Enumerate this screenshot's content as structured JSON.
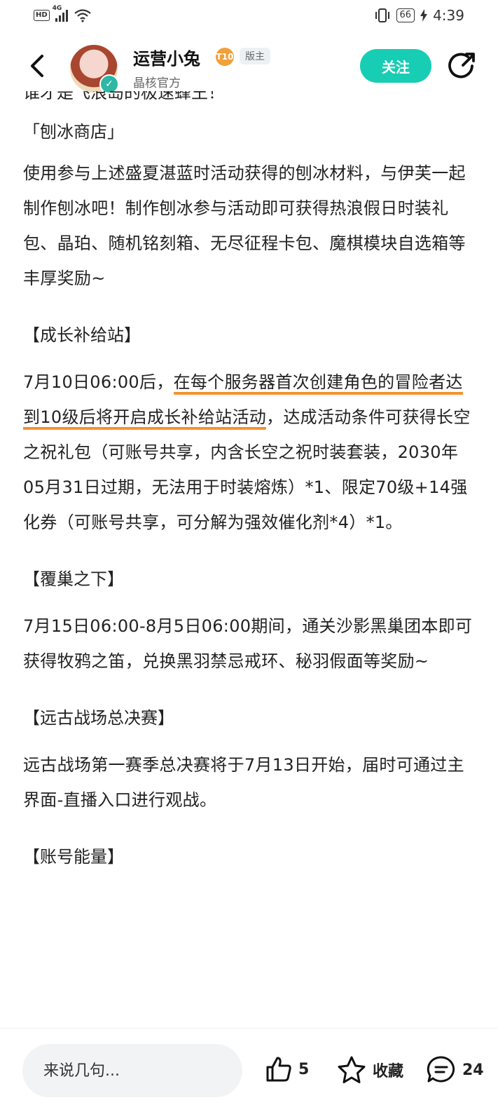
{
  "status_bar": {
    "hd": "HD",
    "network": "4G",
    "battery": "66",
    "time": "4:39"
  },
  "header": {
    "username": "运营小兔",
    "level": "T10",
    "badge": "版主",
    "subtitle": "晶核官方",
    "follow_label": "关注"
  },
  "content": {
    "cut_line": "谁才是飞浪岛的极速蜂王！",
    "sections": [
      {
        "title": "「刨冰商店」",
        "body": "使用参与上述盛夏湛蓝时活动获得的刨冰材料，与伊芙一起制作刨冰吧！制作刨冰参与活动即可获得热浪假日时装礼包、晶珀、随机铭刻箱、无尽征程卡包、魔棋模块自选箱等丰厚奖励~"
      },
      {
        "title": "【成长补给站】",
        "body_pre": "7月10日06:00后，",
        "body_highlight": "在每个服务器首次创建角色的冒险者达到10级后将开启成长补给站活动",
        "body_post": "，达成活动条件可获得长空之祝礼包（可账号共享，内含长空之祝时装套装，2030年05月31日过期，无法用于时装熔炼）*1、限定70级+14强化券（可账号共享，可分解为强效催化剂*4）*1。"
      },
      {
        "title": "【覆巢之下】",
        "body": "7月15日06:00-8月5日06:00期间，通关沙影黑巢团本即可获得牧鸦之笛，兑换黑羽禁忌戒环、秘羽假面等奖励~"
      },
      {
        "title": "【远古战场总决赛】",
        "body": "远古战场第一赛季总决赛将于7月13日开始，届时可通过主界面-直播入口进行观战。"
      },
      {
        "title": "【账号能量】"
      }
    ]
  },
  "bottom_bar": {
    "comment_placeholder": "来说几句...",
    "like_count": "5",
    "favorite_label": "收藏",
    "comment_count": "24"
  },
  "colors": {
    "accent": "#17cdb3",
    "highlight": "#f5922f"
  }
}
